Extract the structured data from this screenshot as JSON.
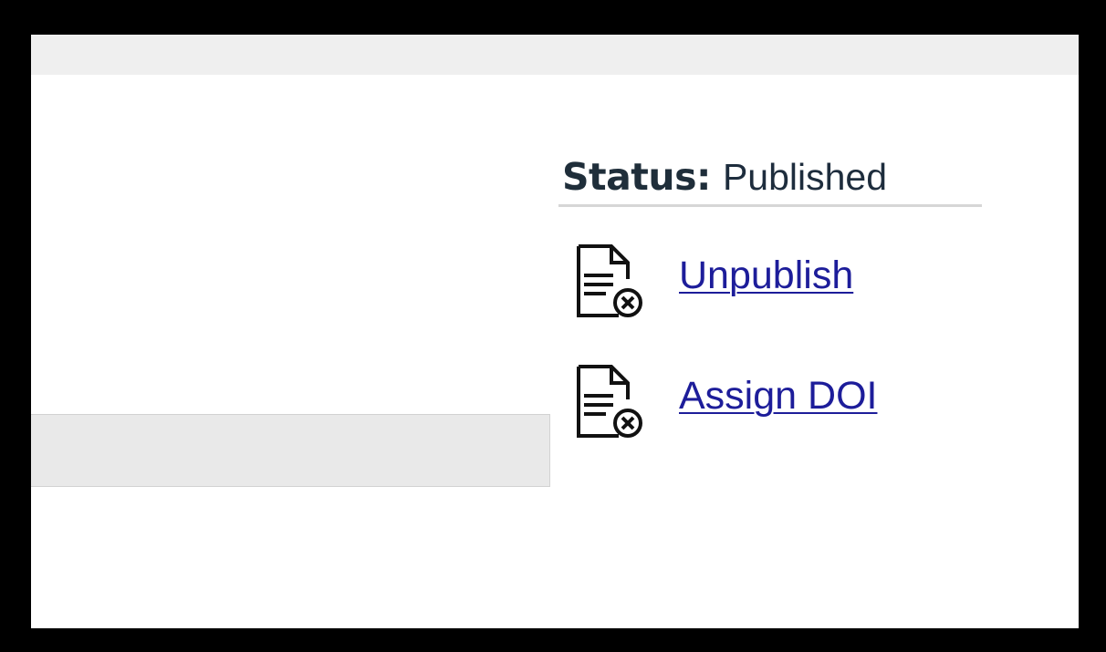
{
  "status": {
    "label": "Status:",
    "value": "Published"
  },
  "actions": [
    {
      "label": "Unpublish",
      "icon": "document-remove-icon"
    },
    {
      "label": "Assign DOI",
      "icon": "document-remove-icon"
    }
  ],
  "colors": {
    "link": "#1d1d9a",
    "status_text": "#1e2d3d",
    "divider": "#d6d6d6",
    "panel": "#e9e9e9",
    "top_bar": "#efefef",
    "frame": "#000000"
  }
}
